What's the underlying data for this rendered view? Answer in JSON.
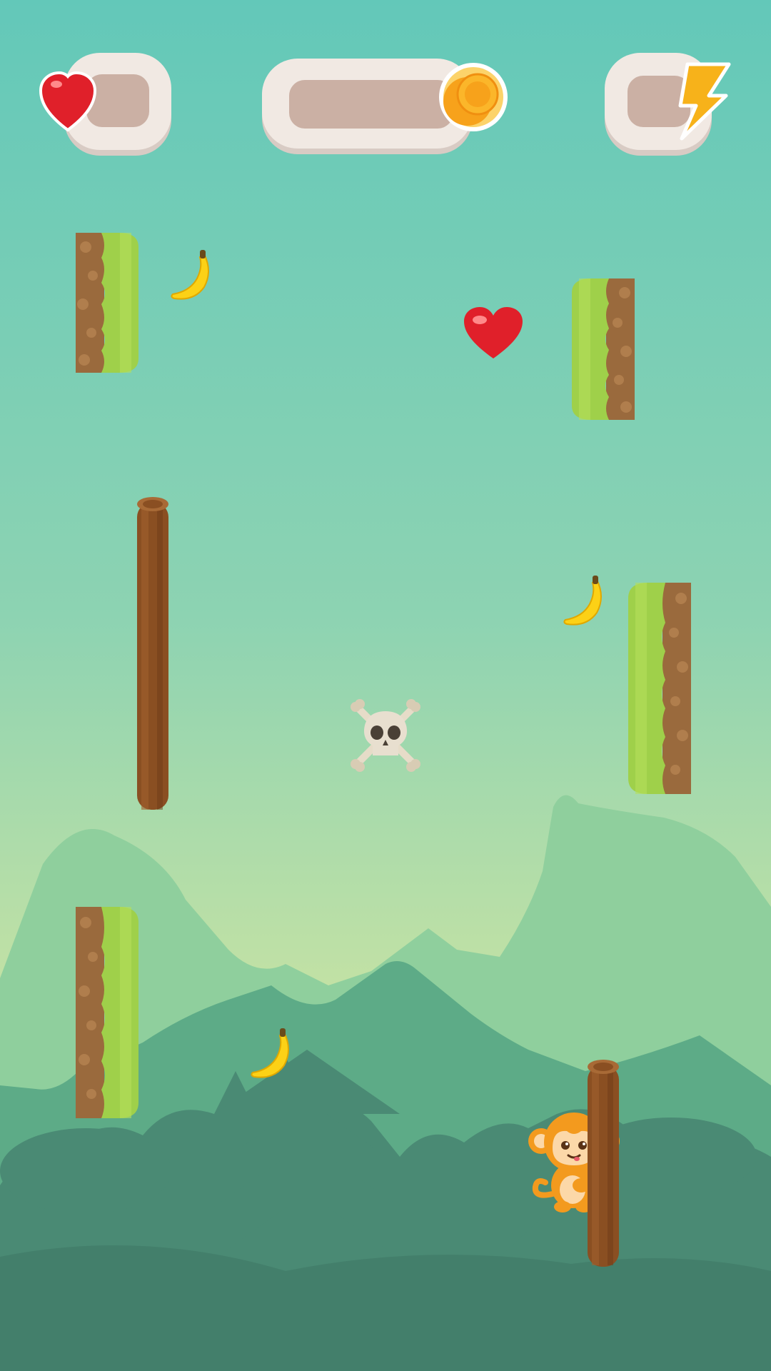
{
  "hud": {
    "lives_icon": "heart-icon",
    "lives_value": "",
    "coins_icon": "coin-stack-icon",
    "coins_value": "",
    "energy_icon": "lightning-bolt-icon",
    "energy_value": ""
  },
  "pickups": {
    "banana_icon": "banana-icon",
    "heart_icon": "heart-icon",
    "hazard_icon": "skull-crossbones-icon"
  },
  "player": {
    "character_icon": "monkey-icon"
  },
  "colors": {
    "sky_top": "#63c8b9",
    "sky_bottom": "#c8e3a3",
    "panel": "#f1e9e3",
    "panel_inner": "#cbb0a4",
    "heart": "#e0202a",
    "coin": "#f7a21b",
    "bolt": "#f7b21a",
    "grass": "#9fd04a",
    "dirt": "#9a6a3d",
    "wood": "#8a4f22",
    "mountain_far": "#8fcf9d",
    "mountain_mid": "#5dab87",
    "jungle_dark": "#4a8a74"
  }
}
